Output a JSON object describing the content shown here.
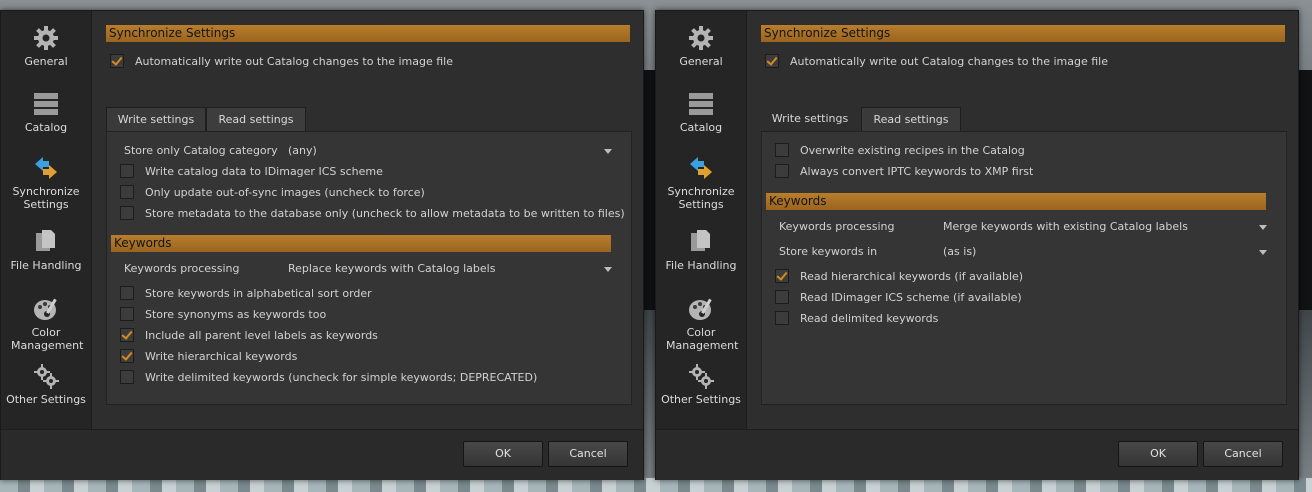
{
  "left": {
    "sidebar": [
      {
        "label": "General",
        "icon": "gear-icon"
      },
      {
        "label": "Catalog",
        "icon": "catalog-stack-icon"
      },
      {
        "label": "Synchronize Settings",
        "icon": "sync-arrows-icon"
      },
      {
        "label": "File Handling",
        "icon": "files-icon"
      },
      {
        "label": "Color Management",
        "icon": "palette-icon"
      },
      {
        "label": "Other Settings",
        "icon": "gears-icon"
      }
    ],
    "section_title": "Synchronize Settings",
    "auto_write": {
      "label": "Automatically write out Catalog changes to the image file",
      "checked": true
    },
    "tabs": {
      "write": "Write settings",
      "read": "Read settings",
      "active": "write"
    },
    "store_only": {
      "label": "Store only Catalog category",
      "value": "(any)"
    },
    "write_options": [
      {
        "label": "Write catalog data to IDimager ICS scheme",
        "checked": false
      },
      {
        "label": "Only update out-of-sync images (uncheck to force)",
        "checked": false
      },
      {
        "label": "Store metadata to the database only (uncheck to allow metadata to be written to files)",
        "checked": false
      }
    ],
    "keywords_title": "Keywords",
    "keywords_processing": {
      "label": "Keywords processing",
      "value": "Replace keywords with Catalog labels"
    },
    "keyword_options": [
      {
        "label": "Store keywords in alphabetical sort order",
        "checked": false
      },
      {
        "label": "Store synonyms as keywords too",
        "checked": false
      },
      {
        "label": "Include all parent level labels as keywords",
        "checked": true
      },
      {
        "label": "Write hierarchical keywords",
        "checked": true
      },
      {
        "label": "Write delimited keywords (uncheck for simple keywords; DEPRECATED)",
        "checked": false
      }
    ],
    "ok": "OK",
    "cancel": "Cancel"
  },
  "right": {
    "sidebar": [
      {
        "label": "General",
        "icon": "gear-icon"
      },
      {
        "label": "Catalog",
        "icon": "catalog-stack-icon"
      },
      {
        "label": "Synchronize Settings",
        "icon": "sync-arrows-icon"
      },
      {
        "label": "File Handling",
        "icon": "files-icon"
      },
      {
        "label": "Color Management",
        "icon": "palette-icon"
      },
      {
        "label": "Other Settings",
        "icon": "gears-icon"
      }
    ],
    "section_title": "Synchronize Settings",
    "auto_write": {
      "label": "Automatically write out Catalog changes to the image file",
      "checked": true
    },
    "tabs": {
      "write": "Write settings",
      "read": "Read settings",
      "active": "read"
    },
    "read_options": [
      {
        "label": "Overwrite existing recipes in the Catalog",
        "checked": false
      },
      {
        "label": "Always convert IPTC keywords to XMP first",
        "checked": false
      }
    ],
    "keywords_title": "Keywords",
    "keywords_processing": {
      "label": "Keywords processing",
      "value": "Merge keywords with existing Catalog labels"
    },
    "store_keywords_in": {
      "label": "Store keywords in",
      "value": "(as is)"
    },
    "keyword_options": [
      {
        "label": "Read hierarchical keywords (if available)",
        "checked": true
      },
      {
        "label": "Read IDimager ICS scheme (if available)",
        "checked": false
      },
      {
        "label": "Read delimited keywords",
        "checked": false
      }
    ],
    "ok": "OK",
    "cancel": "Cancel"
  },
  "colors": {
    "accent": "#b97e2c",
    "check": "#d68a23",
    "dialog_bg": "#2b2b2b"
  }
}
